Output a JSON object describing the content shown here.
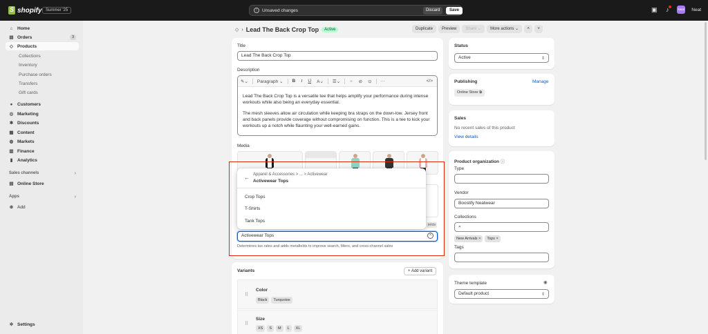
{
  "topbar": {
    "brand": "shopify",
    "edition": "Summer '25",
    "unsaved": "Unsaved changes",
    "discard": "Discard",
    "save": "Save",
    "avatar_initials": "Neat",
    "store_name": "Neat"
  },
  "sidebar": {
    "items": [
      {
        "label": "Home",
        "icon": "⌂"
      },
      {
        "label": "Orders",
        "icon": "▤",
        "badge": "3"
      },
      {
        "label": "Products",
        "icon": "◇"
      },
      {
        "label": "Collections"
      },
      {
        "label": "Inventory"
      },
      {
        "label": "Purchase orders"
      },
      {
        "label": "Transfers"
      },
      {
        "label": "Gift cards"
      },
      {
        "label": "Customers",
        "icon": "●"
      },
      {
        "label": "Marketing",
        "icon": "◎"
      },
      {
        "label": "Discounts",
        "icon": "✱"
      },
      {
        "label": "Content",
        "icon": "▦"
      },
      {
        "label": "Markets",
        "icon": "◍"
      },
      {
        "label": "Finance",
        "icon": "▥"
      },
      {
        "label": "Analytics",
        "icon": "▮"
      }
    ],
    "sales_channels": "Sales channels",
    "online_store": "Online Store",
    "apps": "Apps",
    "add": "Add",
    "settings": "Settings"
  },
  "header": {
    "title": "Lead The Back Crop Top",
    "status": "Active",
    "duplicate": "Duplicate",
    "preview": "Preview",
    "share": "Share",
    "more_actions": "More actions"
  },
  "main": {
    "title_label": "Title",
    "title_value": "Lead The Back Crop Top",
    "description_label": "Description",
    "paragraph": "Paragraph",
    "desc_p1": "Lead The Back Crop Top is a versatile tee that helps amplify your performance during intense workouts while also being an everyday essential.",
    "desc_p2": "The mesh sleeves allow air circulation while keeping bra straps on the down-low. Jersey front and back panels provide coverage without compromising on function. This is a tee to kick your workouts up a notch while flaunting your well-earned gains.",
    "media_label": "Media",
    "fields_fragment": "ields"
  },
  "category": {
    "breadcrumb": "Apparel & Accessories  >  ...  >  Activewear",
    "current": "Activewear Tops",
    "options": [
      "Crop Tops",
      "T-Shirts",
      "Tank Tops"
    ],
    "value": "Activewear Tops",
    "help": "Determines tax rates and adds metafields to improve search, filters, and cross-channel sales"
  },
  "variants": {
    "label": "Variants",
    "add": "+ Add variant",
    "color_label": "Color",
    "colors": [
      "Black",
      "Turquoise"
    ],
    "size_label": "Size",
    "sizes": [
      "XS",
      "S",
      "M",
      "L",
      "XL"
    ]
  },
  "right": {
    "status_label": "Status",
    "status_value": "Active",
    "publishing_label": "Publishing",
    "manage": "Manage",
    "online_store": "Online Store",
    "sales_label": "Sales",
    "sales_text": "No recent sales of this product",
    "view_details": "View details",
    "org_label": "Product organization",
    "type_label": "Type",
    "vendor_label": "Vendor",
    "vendor_value": "Boostify Neatwear",
    "collections_label": "Collections",
    "collections": [
      "New Arrivals",
      "Tops"
    ],
    "tags_label": "Tags",
    "theme_label": "Theme template",
    "theme_value": "Default product"
  },
  "colors": {
    "topbar": "#1a1a1a",
    "active_badge": "#b4fed2",
    "link": "#005bd3",
    "highlight": "#d82c0d"
  }
}
